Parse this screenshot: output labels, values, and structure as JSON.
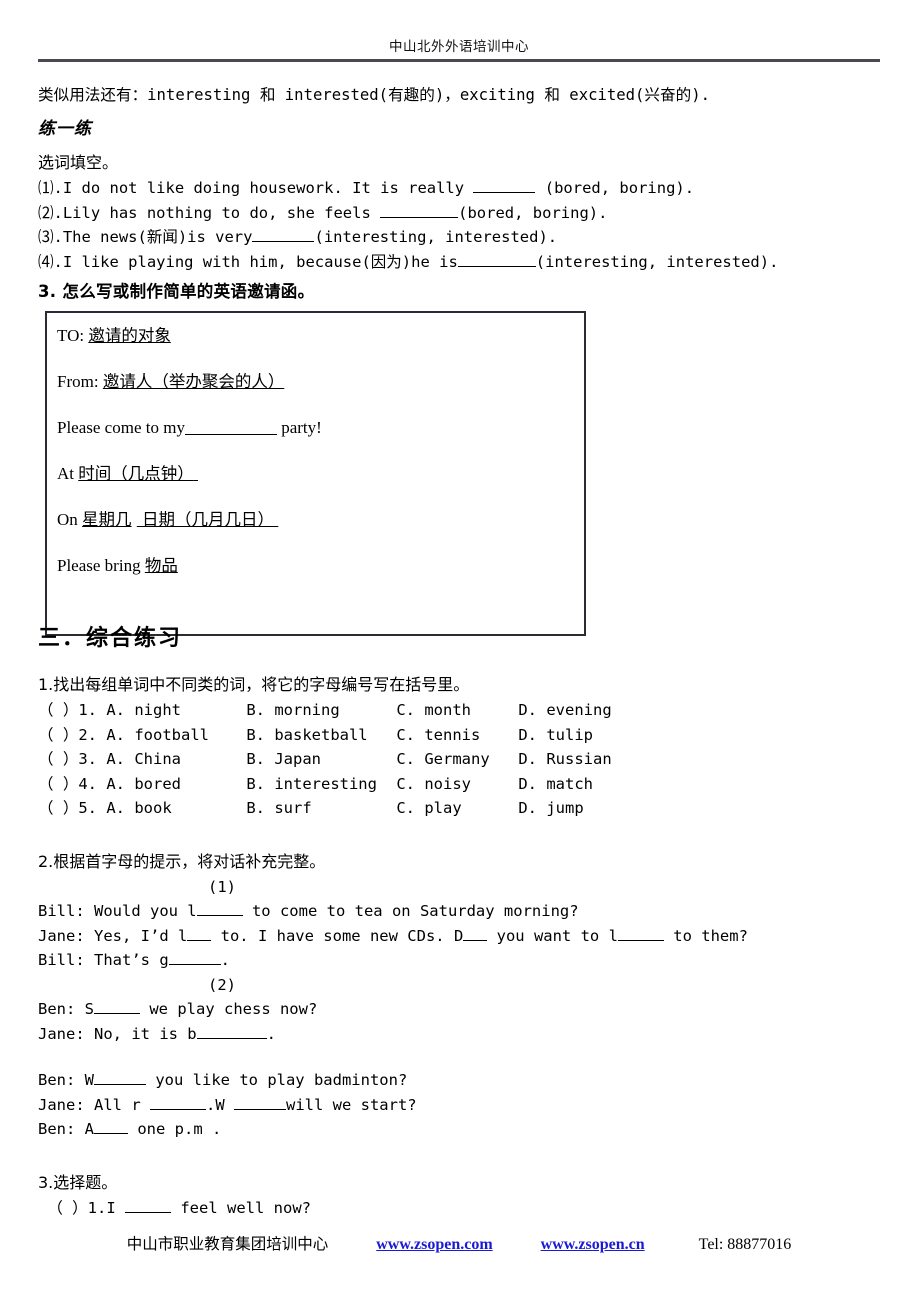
{
  "header": {
    "title": "中山北外外语培训中心"
  },
  "intro": {
    "line": "类似用法还有：interesting 和 interested(有趣的)，exciting 和 excited(兴奋的)."
  },
  "practice": {
    "heading": "练一练",
    "prompt": "选词填空。",
    "questions": [
      {
        "before": "⑴.I do not like doing housework. It is really ",
        "after": " (bored, boring).",
        "blank": "short"
      },
      {
        "before": "⑵.Lily has nothing to do, she feels ",
        "after": "(bored, boring).",
        "blank": "medium"
      },
      {
        "before": "⑶.The news(新闻)is very",
        "after": "(interesting, interested).",
        "blank": "short"
      },
      {
        "before": "⑷.I like playing with him, because(因为)he is",
        "after": "(interesting, interested).",
        "blank": "medium"
      }
    ]
  },
  "invitation_heading": "3.  怎么写或制作简单的英语邀请函。",
  "invitation": {
    "to_label": "TO: ",
    "to_value": "邀请的对象",
    "from_label": "From: ",
    "from_value": "邀请人（举办聚会的人）",
    "please_come_before": "Please come to my",
    "please_come_after": " party!",
    "at_label": "At ",
    "at_value": "时间（几点钟）",
    "on_label": "On",
    "on_value_1": "星期几",
    "on_value_2": " 日期（几月几日）",
    "bring_label": "Please bring ",
    "bring_value": "物品"
  },
  "section_three": {
    "heading": "三．综合练习"
  },
  "exercise1": {
    "prompt": "1.找出每组单词中不同类的词，将它的字母编号写在括号里。",
    "rows": [
      {
        "mark": "（ ）1. ",
        "a": "A. night",
        "b": "B. morning",
        "c": "C. month",
        "d": "D. evening"
      },
      {
        "mark": "（ ）2. ",
        "a": "A. football",
        "b": "B. basketball",
        "c": "C. tennis",
        "d": "D. tulip"
      },
      {
        "mark": "（ ）3. ",
        "a": "A. China",
        "b": "B. Japan",
        "c": "C. Germany",
        "d": "D. Russian"
      },
      {
        "mark": "（ ）4. ",
        "a": "A. bored",
        "b": "B. interesting",
        "c": "C. noisy",
        "d": "D. match"
      },
      {
        "mark": "（ ）5. ",
        "a": "A. book",
        "b": "B. surf",
        "c": "C. play",
        "d": "D. jump"
      }
    ]
  },
  "exercise2": {
    "prompt": "2.根据首字母的提示，将对话补充完整。",
    "dialog1_number": "(1)",
    "d1_l1_a": "Bill: Would you l",
    "d1_l1_b": " to come to tea on Saturday morning?",
    "d1_l2_a": "Jane: Yes, I’d l",
    "d1_l2_b": " to. I have some new CDs. D",
    "d1_l2_c": " you want to l",
    "d1_l2_d": " to them?",
    "d1_l3_a": "Bill: That’s g",
    "d1_l3_b": ".",
    "dialog2_number": "(2)",
    "d2_l1_a": "Ben: S",
    "d2_l1_b": " we play chess now?",
    "d2_l2_a": "Jane: No, it is b",
    "d2_l2_b": ".",
    "d2_l3_a": "Ben: W",
    "d2_l3_b": " you like to play badminton?",
    "d2_l4_a": "Jane: All r ",
    "d2_l4_b": ".W ",
    "d2_l4_c": "will we start?",
    "d2_l5_a": "Ben: A",
    "d2_l5_b": " one p.m ."
  },
  "exercise3": {
    "prompt": "3.选择题。",
    "q1_a": " （ ）1.I ",
    "q1_b": " feel well now?"
  },
  "footer": {
    "org": "中山市职业教育集团培训中心",
    "link1": "www.zsopen.com",
    "link2": "www.zsopen.cn",
    "tel": "Tel: 88877016"
  },
  "colors": {
    "link": "#1a1ad6",
    "rule": "#4a4a52",
    "box_border": "#2b2b33"
  }
}
